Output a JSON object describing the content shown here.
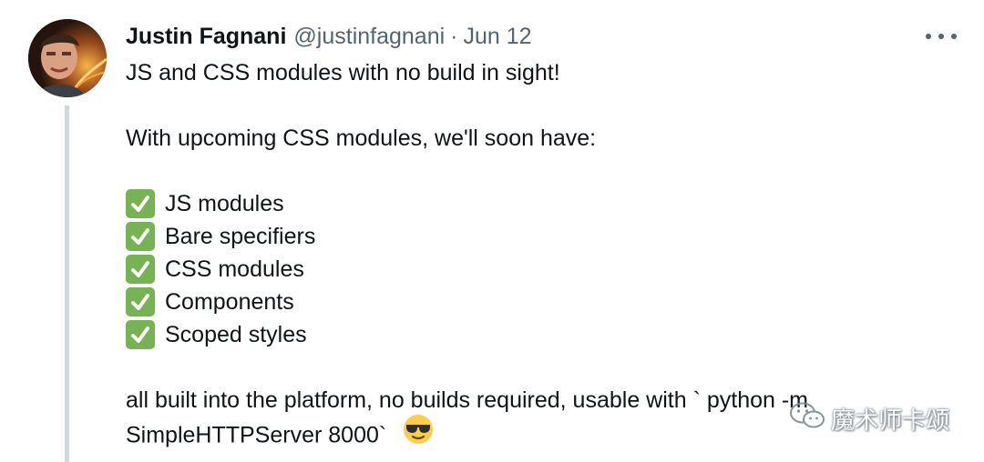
{
  "tweet": {
    "author": {
      "display_name": "Justin Fagnani",
      "handle": "@justinfagnani",
      "separator": "·",
      "date": "Jun 12"
    },
    "more_icon": "more-horizontal-icon",
    "intro": "JS and CSS modules with no build in sight!",
    "lead": "With upcoming CSS modules, we'll soon have:",
    "checklist": [
      "JS modules",
      "Bare specifiers",
      "CSS modules",
      "Components",
      "Scoped styles"
    ],
    "closing_line1": "all built into the platform, no builds required, usable with ` python -m",
    "closing_line2": "SimpleHTTPServer 8000`",
    "checkmark_icon": "white-check-mark-icon",
    "emoji": "smiling-face-with-sunglasses-icon"
  },
  "watermark": {
    "text": "魔术师卡颂",
    "icon": "wechat-icon"
  },
  "colors": {
    "text": "#0f1419",
    "secondary": "#536471",
    "thread_line": "#cfd9de",
    "check_green": "#77b255",
    "emoji_yellow": "#ffcc4d"
  }
}
